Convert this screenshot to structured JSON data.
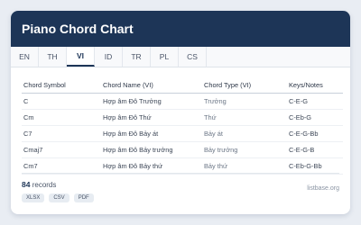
{
  "header": {
    "title": "Piano Chord Chart"
  },
  "tabs": [
    {
      "label": "EN"
    },
    {
      "label": "TH"
    },
    {
      "label": "VI"
    },
    {
      "label": "ID"
    },
    {
      "label": "TR"
    },
    {
      "label": "PL"
    },
    {
      "label": "CS"
    }
  ],
  "active_tab": "VI",
  "table": {
    "columns": [
      "Chord Symbol",
      "Chord Name (VI)",
      "Chord Type (VI)",
      "Keys/Notes"
    ],
    "rows": [
      [
        "C",
        "Hợp âm Đô Trưởng",
        "Trưởng",
        "C-E-G"
      ],
      [
        "Cm",
        "Hợp âm Đô Thứ",
        "Thứ",
        "C-Eb-G"
      ],
      [
        "C7",
        "Hợp âm Đô Bảy át",
        "Bảy át",
        "C-E-G-Bb"
      ],
      [
        "Cmaj7",
        "Hợp âm Đô Bảy trưởng",
        "Bảy trưởng",
        "C-E-G-B"
      ],
      [
        "Cm7",
        "Hợp âm Đô Bảy thứ",
        "Bảy thứ",
        "C-Eb-G-Bb"
      ]
    ]
  },
  "footer": {
    "count": "84",
    "count_label": "records",
    "exports": [
      "XLSX",
      "CSV",
      "PDF"
    ],
    "source": "listbase.org"
  },
  "colors": {
    "header_bg": "#1d3557",
    "background": "#e9edf3"
  }
}
